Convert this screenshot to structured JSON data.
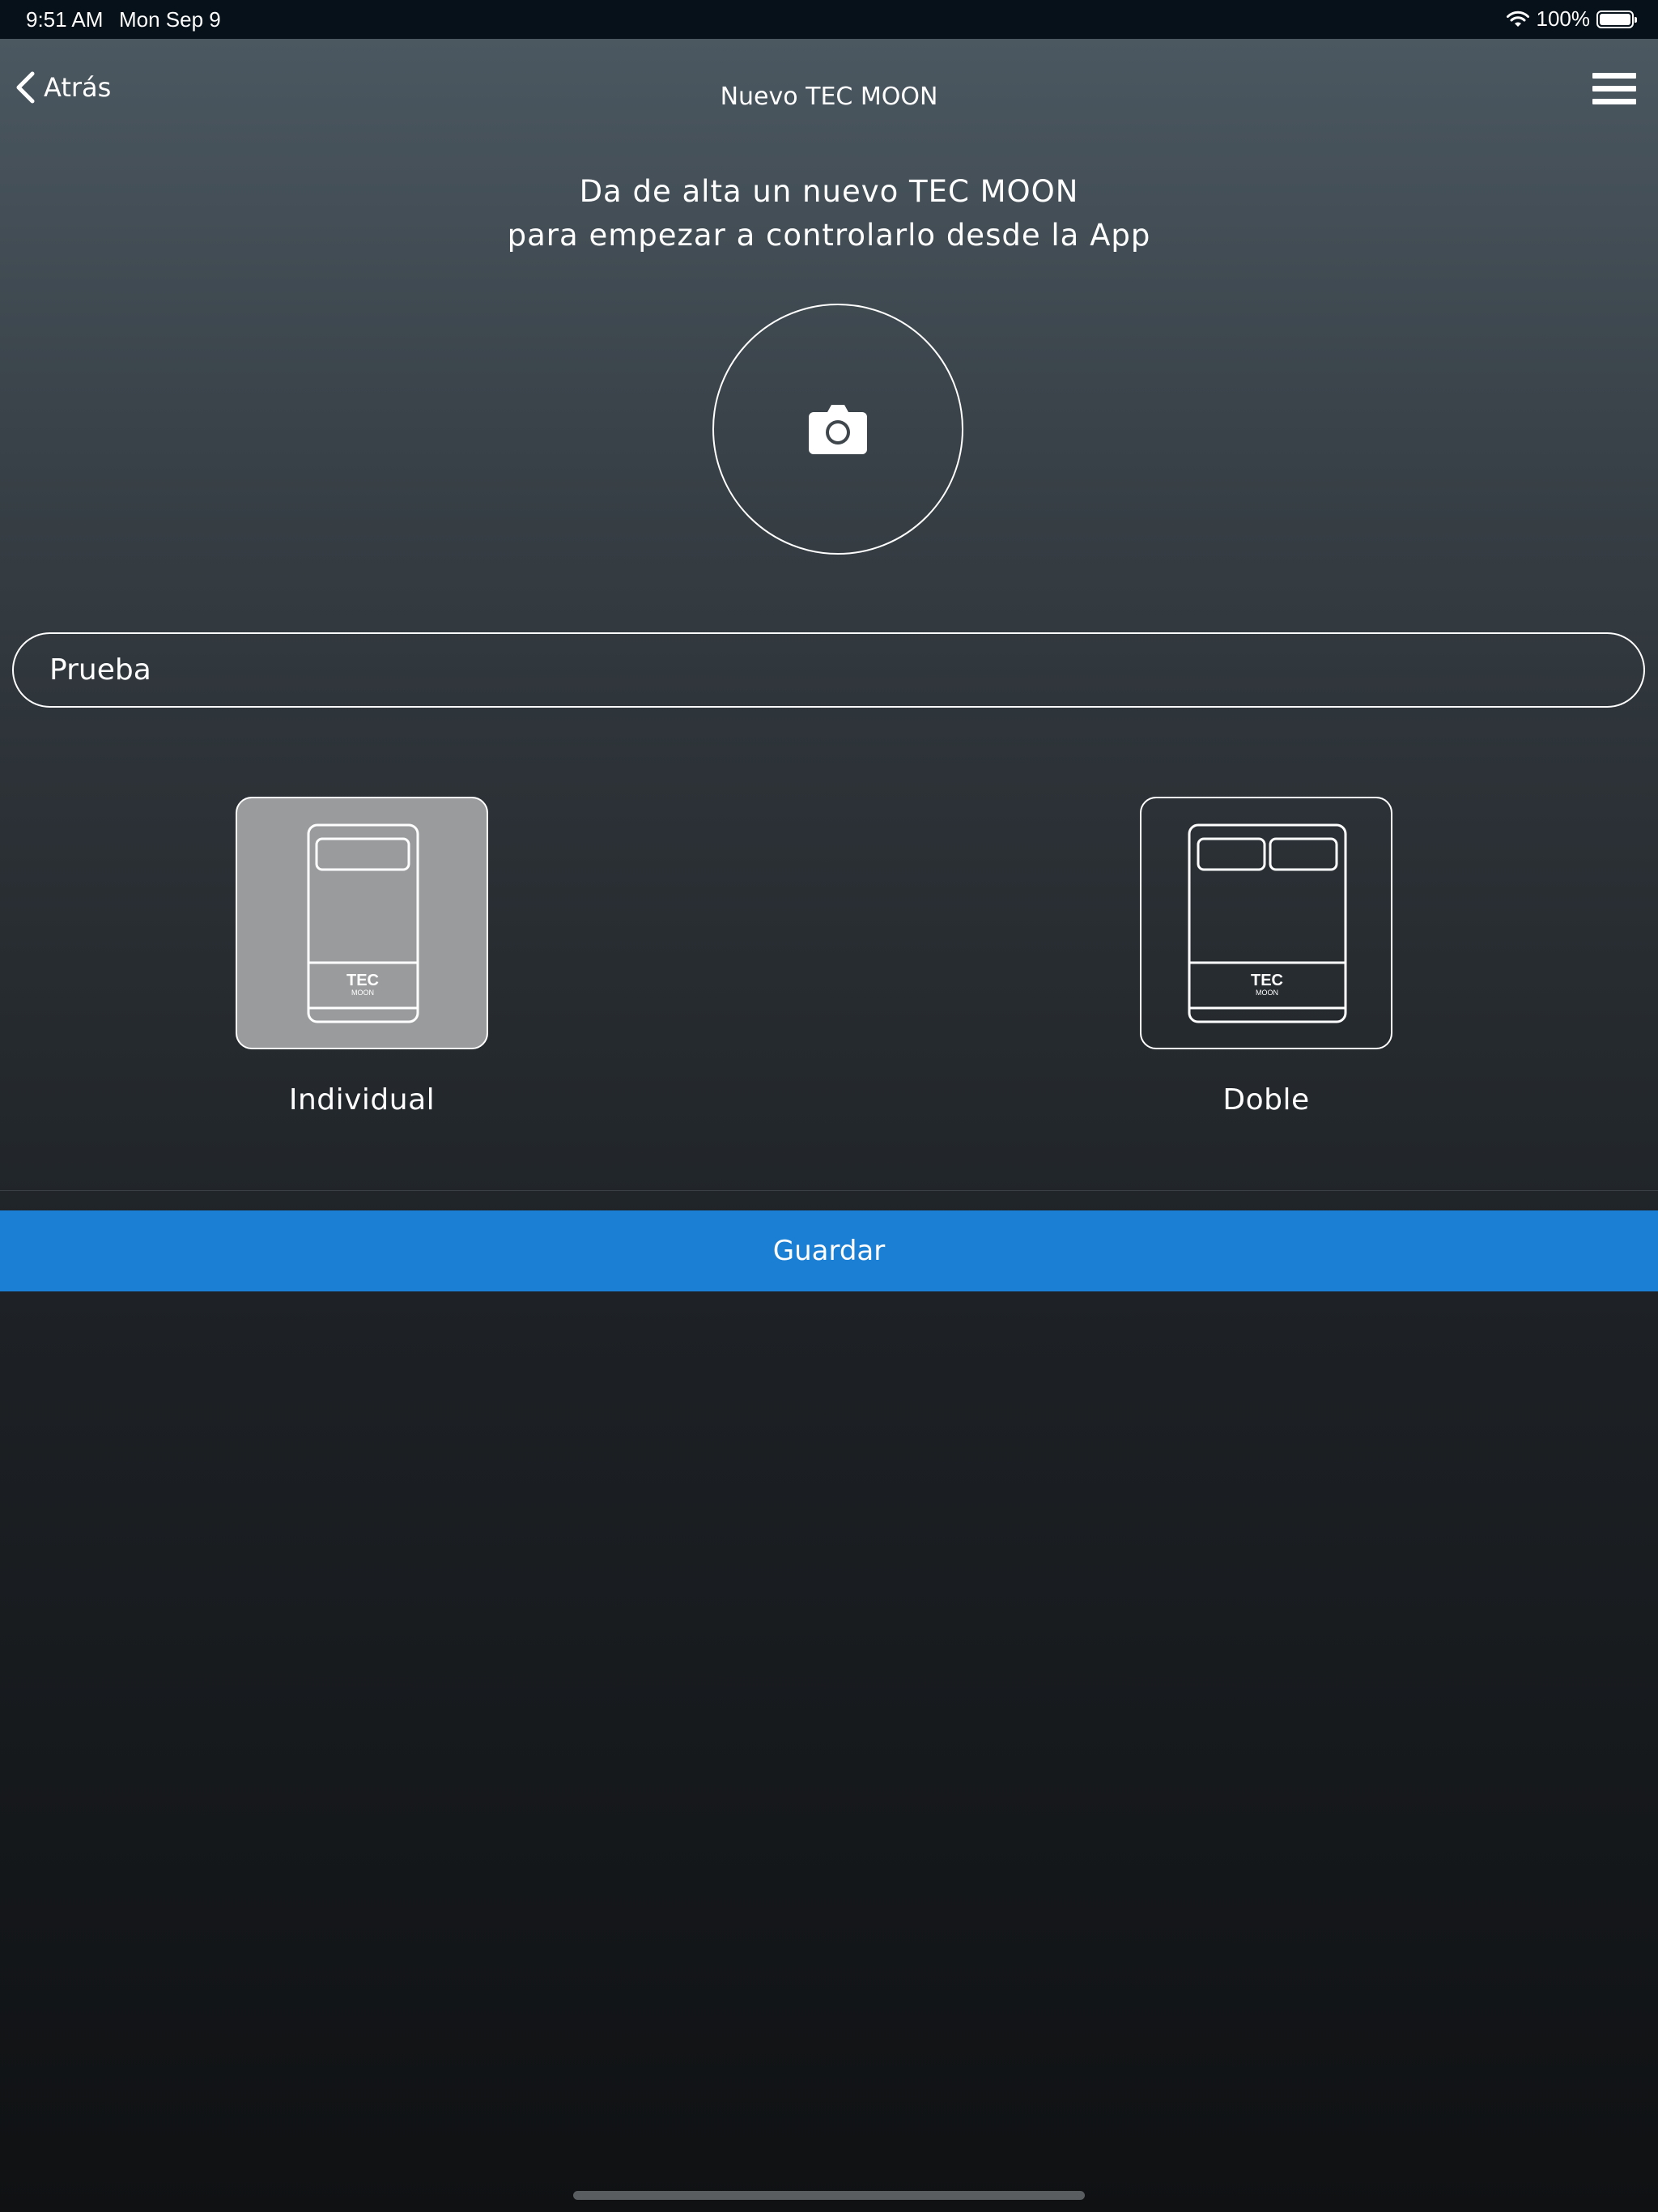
{
  "status_bar": {
    "time": "9:51 AM",
    "date": "Mon Sep 9",
    "battery": "100%",
    "battery_level": 1.0
  },
  "nav": {
    "back_label": "Atrás",
    "title": "Nuevo TEC MOON",
    "back_icon": "chevron-left-icon",
    "menu_icon": "hamburger-menu-icon"
  },
  "intro": {
    "line1": "Da de alta un nuevo TEC MOON",
    "line2": "para empezar a controlarlo desde la App"
  },
  "photo": {
    "icon": "camera-icon"
  },
  "name_field": {
    "value": "Prueba"
  },
  "types": {
    "individual": {
      "label": "Individual",
      "selected": true,
      "logo_top": "TEC",
      "logo_bottom": "MOON"
    },
    "double": {
      "label": "Doble",
      "selected": false,
      "logo_top": "TEC",
      "logo_bottom": "MOON"
    }
  },
  "save": {
    "label": "Guardar"
  },
  "colors": {
    "accent": "#1b7fd4",
    "selected_tile": "#9a9b9d",
    "status_bar": "#07111a"
  }
}
